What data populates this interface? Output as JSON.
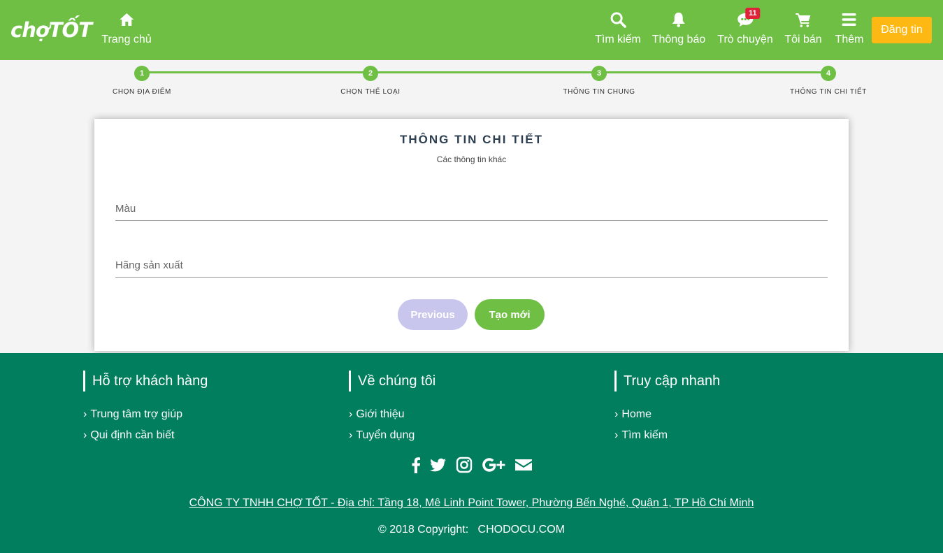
{
  "header": {
    "logo": "chợTỐT",
    "nav": [
      {
        "label": "Trang chủ",
        "icon": "home-icon"
      },
      {
        "label": "Tìm kiếm",
        "icon": "search-icon"
      },
      {
        "label": "Thông báo",
        "icon": "bell-icon"
      },
      {
        "label": "Trò chuyện",
        "icon": "chat-icon",
        "badge": "11"
      },
      {
        "label": "Tôi bán",
        "icon": "cart-icon"
      },
      {
        "label": "Thêm",
        "icon": "menu-icon"
      }
    ],
    "post_button": "Đăng tin",
    "colors": {
      "brand": "#6ebf44",
      "post": "#fdb813",
      "badge": "#e0213a"
    }
  },
  "stepper": {
    "steps": [
      {
        "number": "1",
        "label": "CHỌN ĐỊA ĐIỂM"
      },
      {
        "number": "2",
        "label": "CHỌN THỂ LOẠI"
      },
      {
        "number": "3",
        "label": "THÔNG TIN CHUNG"
      },
      {
        "number": "4",
        "label": "THÔNG TIN CHI TIẾT"
      }
    ]
  },
  "form": {
    "title": "THÔNG TIN CHI TIẾT",
    "subtitle": "Các thông tin khác",
    "fields": [
      {
        "placeholder": "Màu",
        "value": ""
      },
      {
        "placeholder": "Hãng sản xuất",
        "value": ""
      }
    ],
    "previous_label": "Previous",
    "submit_label": "Tạo mới"
  },
  "footer": {
    "columns": [
      {
        "title": "Hỗ trợ khách hàng",
        "links": [
          "Trung tâm trợ giúp",
          "Qui định cần biết"
        ]
      },
      {
        "title": "Về chúng tôi",
        "links": [
          "Giới thiệu",
          "Tuyển dụng"
        ]
      },
      {
        "title": "Truy cập nhanh",
        "links": [
          "Home",
          "Tìm kiếm"
        ]
      }
    ],
    "socials": [
      "facebook-icon",
      "twitter-icon",
      "instagram-icon",
      "google-plus-icon",
      "email-icon"
    ],
    "company": "CÔNG TY TNHH CHỢ TỐT - Địa chỉ: Tầng 18, Mê Linh Point Tower, Phường Bến Nghé, Quận 1, TP Hồ Chí Minh",
    "copyright": "© 2018 Copyright:",
    "copyright_link": "CHODOCU.COM",
    "color": "#007e5e"
  }
}
